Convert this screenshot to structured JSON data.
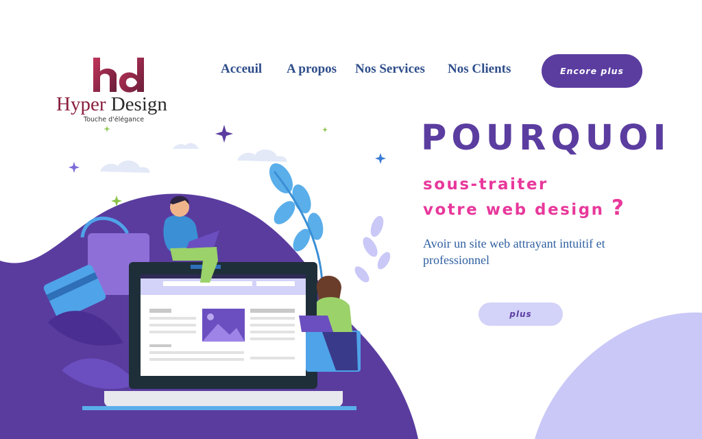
{
  "brand": {
    "name_part1": "Hyper",
    "name_part2": " Design",
    "tagline": "Touche d'élégance",
    "color": "#8a1f3d"
  },
  "nav": {
    "items": [
      {
        "label": "Acceuil"
      },
      {
        "label": "A propos"
      },
      {
        "label": "Nos Services"
      },
      {
        "label": "Nos Clients"
      }
    ],
    "cta_label": "Encore plus"
  },
  "hero": {
    "title": "POURQUOI",
    "subtitle_line1": "sous-traiter",
    "subtitle_line2": "votre web design",
    "subtitle_mark": "?",
    "description": "Avoir un site web attrayant intuitif et professionnel",
    "button_label": "plus"
  },
  "colors": {
    "primary": "#5b3da0",
    "accent": "#e8389b",
    "text_blue": "#2e5fa0",
    "nav_blue": "#2e4d8a",
    "light_lavender": "#c9c8f7"
  },
  "icons": [
    "hd-logo-mark-icon",
    "web-design-illustration-icon",
    "sparkle-icon",
    "cloud-icon",
    "leaf-icon"
  ]
}
